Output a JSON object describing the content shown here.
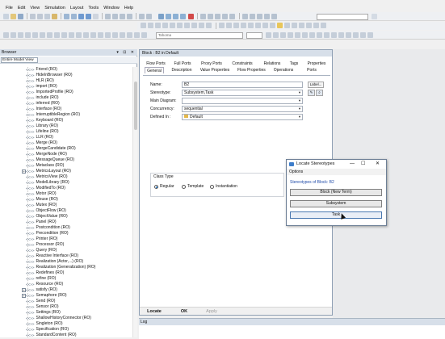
{
  "menubar": [
    "File",
    "Edit",
    "View",
    "Simulation",
    "Layout",
    "Tools",
    "Window",
    "Help"
  ],
  "toolbar": {
    "font_combo": "Tahoma"
  },
  "browser": {
    "title": "Browser",
    "filter": "Entire Model View",
    "items": [
      "Friend (RO)",
      "HideInBrowser (RO)",
      "HLR (RO)",
      "import (RO)",
      "ImportedProfile (RO)",
      "include (RO)",
      "inferred (RO)",
      "Interface (RO)",
      "InterruptibleRegion (RO)",
      "Keyboard (RO)",
      "Library (RO)",
      "Lifeline (RO)",
      "LLR (RO)",
      "Merge (RO)",
      "MergeCandidate (RO)",
      "MergeNode (RO)",
      "MessageQueue (RO)",
      "Metaclass (RO)",
      "MetricsLayout (RO)",
      "MetricsView (RO)",
      "ModelLibrary (RO)",
      "ModifiedTo (RO)",
      "Motor (RO)",
      "Mouse (RO)",
      "Mutex (RO)",
      "ObjectFlow (RO)",
      "ObjectValue (RO)",
      "Panel (RO)",
      "Postcondition (RO)",
      "Precondition (RO)",
      "Printer (RO)",
      "Processor (RO)",
      "Query (RO)",
      "Reactive Interface (RO)",
      "Realization (Actor,...) (RO)",
      "Realization (Generalization) (RO)",
      "Redefines (RO)",
      "refine (RO)",
      "Resource (RO)",
      "satisfy (RO)",
      "Semaphore (RO)",
      "Send (RO)",
      "Sensor (RO)",
      "Settings (RO)",
      "ShallowHistoryConnector (RO)",
      "Singleton (RO)",
      "Specification (RO)",
      "StandardContent (RO)"
    ],
    "relation_marker": "<<>>"
  },
  "block_dialog": {
    "title": "Block : B2 in Default",
    "tabs_row1": [
      "Flow Ports",
      "Full Ports",
      "Proxy Ports",
      "Constraints",
      "Relations",
      "Tags",
      "Properties"
    ],
    "tabs_row2": [
      "General",
      "Description",
      "Value Properties",
      "Flow Properties",
      "Operations",
      "Ports"
    ],
    "fields": {
      "name_label": "Name:",
      "name_value": "B2",
      "stereotype_label": "Stereotype:",
      "stereotype_value": "Subsystem,Task",
      "main_diagram_label": "Main Diagram:",
      "main_diagram_value": "",
      "concurrency_label": "Concurrency:",
      "concurrency_value": "sequential",
      "defined_in_label": "Defined In :",
      "defined_in_value": "Default"
    },
    "label_button": "Label...",
    "class_type": {
      "label": "Class Type",
      "options": [
        "Regular",
        "Template",
        "Instantiation"
      ],
      "selected": "Regular"
    },
    "buttons": {
      "locate": "Locate",
      "ok": "OK",
      "apply": "Apply"
    }
  },
  "locate_dialog": {
    "title": "Locate Stereotypes",
    "menu": "Options",
    "subtitle": "Stereotypes of Block: B2",
    "stereotypes": [
      "Block (New Term)",
      "Subsystem",
      "Task"
    ],
    "window_controls": [
      "—",
      "☐",
      "✕"
    ]
  },
  "log": {
    "title": "Log"
  },
  "colors": {
    "panel_header": "#d7dfe9",
    "accent": "#1f4aa8"
  }
}
